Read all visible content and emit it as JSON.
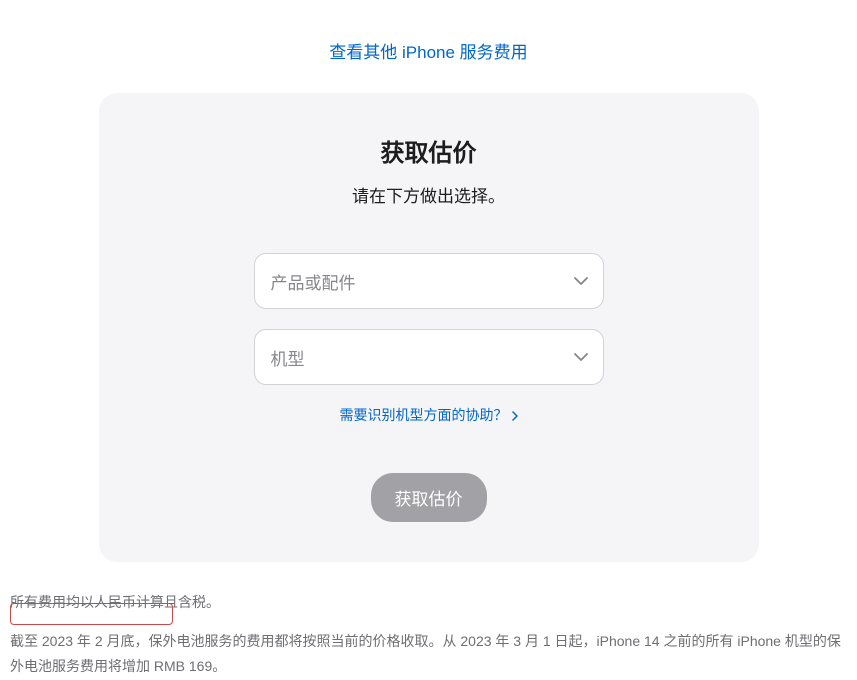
{
  "topLink": {
    "label": "查看其他 iPhone 服务费用"
  },
  "card": {
    "title": "获取估价",
    "subtitle": "请在下方做出选择。",
    "select1": {
      "placeholder": "产品或配件"
    },
    "select2": {
      "placeholder": "机型"
    },
    "helpLink": "需要识别机型方面的协助？",
    "button": "获取估价"
  },
  "footer": {
    "line1": "所有费用均以人民币计算且含税。",
    "line2": "截至 2023 年 2 月底，保外电池服务的费用都将按照当前的价格收取。从 2023 年 3 月 1 日起，iPhone 14 之前的所有 iPhone 机型的保外电池服务费用将增加 RMB 169。"
  }
}
